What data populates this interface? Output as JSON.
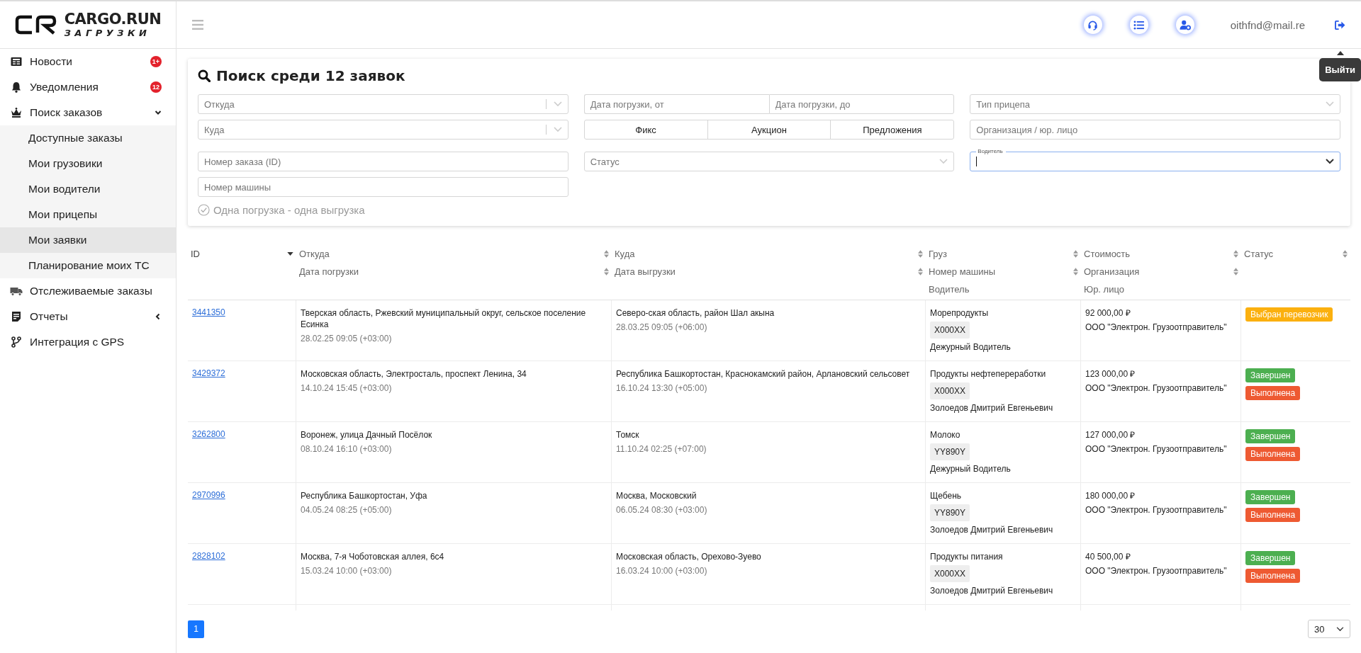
{
  "logo": {
    "name": "CARGO.RUN",
    "subtitle": "ЗАГРУЗКИ"
  },
  "sidebar": {
    "items": [
      {
        "label": "Новости",
        "badge": "1+",
        "selected": false
      },
      {
        "label": "Уведомления",
        "badge": "12",
        "selected": false
      },
      {
        "label": "Поиск заказов",
        "expanded": true,
        "selected": false,
        "children": [
          {
            "label": "Доступные заказы",
            "selected": false
          },
          {
            "label": "Мои грузовики",
            "selected": false
          },
          {
            "label": "Мои водители",
            "selected": false
          },
          {
            "label": "Мои прицепы",
            "selected": false
          },
          {
            "label": "Мои заявки",
            "selected": true
          },
          {
            "label": "Планирование моих ТС",
            "selected": false
          }
        ]
      },
      {
        "label": "Отслеживаемые заказы",
        "selected": false
      },
      {
        "label": "Отчеты",
        "expanded": false,
        "selected": false
      },
      {
        "label": "Интеграция с GPS",
        "selected": false
      }
    ]
  },
  "header": {
    "user": "oithfnd@mail.re",
    "tooltip": "Выйти"
  },
  "search": {
    "title": "Поиск среди 12 заявок",
    "columns": [
      [
        {
          "kind": "combo",
          "placeholder": "Откуда"
        },
        {
          "kind": "combo",
          "placeholder": "Куда"
        },
        {
          "kind": "input",
          "placeholder": "Номер заказа (ID)"
        },
        {
          "kind": "input",
          "placeholder": "Номер машины"
        },
        {
          "kind": "checkbox",
          "label": "Одна погрузка - одна выгрузка",
          "checked": false
        }
      ],
      [
        {
          "kind": "range",
          "placeholders": [
            "Дата погрузки, от",
            "Дата погрузки, до"
          ]
        },
        {
          "kind": "segmented",
          "options": [
            {
              "label": "Фикс",
              "selected": false
            },
            {
              "label": "Аукцион",
              "selected": false
            },
            {
              "label": "Предложения",
              "selected": false
            }
          ]
        },
        {
          "kind": "select",
          "placeholder": "Статус"
        }
      ],
      [
        {
          "kind": "select",
          "placeholder": "Тип прицепа"
        },
        {
          "kind": "input",
          "placeholder": "Организация / юр. лицо"
        },
        {
          "kind": "floating",
          "label": "Водитель",
          "focused": true
        }
      ]
    ]
  },
  "table": {
    "columns": [
      {
        "labels": [
          {
            "text": "ID",
            "sortable": true,
            "sorted": true
          }
        ]
      },
      {
        "labels": [
          {
            "text": "Откуда",
            "sortable": true,
            "sorted": false
          },
          {
            "text": "Дата погрузки",
            "sortable": true,
            "sorted": false
          }
        ]
      },
      {
        "labels": [
          {
            "text": "Куда",
            "sortable": true,
            "sorted": false
          },
          {
            "text": "Дата выгрузки",
            "sortable": true,
            "sorted": false
          }
        ]
      },
      {
        "labels": [
          {
            "text": "Груз",
            "sortable": true,
            "sorted": false
          },
          {
            "text": "Номер машины",
            "sortable": true,
            "sorted": false
          },
          {
            "text": "Водитель",
            "sortable": false,
            "sorted": false
          }
        ]
      },
      {
        "labels": [
          {
            "text": "Стоимость",
            "sortable": true,
            "sorted": false
          },
          {
            "text": "Организация",
            "sortable": true,
            "sorted": false
          },
          {
            "text": "Юр. лицо",
            "sortable": false,
            "sorted": false
          }
        ]
      },
      {
        "labels": [
          {
            "text": "Статус",
            "sortable": true,
            "sorted": false
          }
        ]
      }
    ],
    "rows": [
      {
        "id": "3441350",
        "from": "Тверская область, Ржевский муниципальный округ, сельское поселение Есинка",
        "load_date": "28.02.25 09:05 (+03:00)",
        "to": "Северо-ская область, район Шал акына",
        "unload_date": "28.03.25 09:05 (+06:00)",
        "cargo": "Морепродукты",
        "plate": "X000XX",
        "driver": "Дежурный Водитель",
        "price": "92 000,00 ₽",
        "org": "ООО \"Электрон. Грузоотправитель\"",
        "statuses": [
          {
            "text": "Выбран перевозчик",
            "color": "#fbb00f"
          }
        ]
      },
      {
        "id": "3429372",
        "from": "Московская область, Электросталь, проспект Ленина, 34",
        "load_date": "14.10.24 15:45 (+03:00)",
        "to": "Республика Башкортостан, Краснокамский район, Арлановский сельсовет",
        "unload_date": "16.10.24 13:30 (+05:00)",
        "cargo": "Продукты нефтепереработки",
        "plate": "X000XX",
        "driver": "Золоедов Дмитрий Евгеньевич",
        "price": "123 000,00 ₽",
        "org": "ООО \"Электрон. Грузоотправитель\"",
        "statuses": [
          {
            "text": "Завершен",
            "color": "#4caf50"
          },
          {
            "text": "Выполнена",
            "color": "#ee5a32"
          }
        ]
      },
      {
        "id": "3262800",
        "from": "Воронеж, улица Дачный Посёлок",
        "load_date": "08.10.24 16:10 (+03:00)",
        "to": "Томск",
        "unload_date": "11.10.24 02:25 (+07:00)",
        "cargo": "Молоко",
        "plate": "YY890Y",
        "driver": "Дежурный Водитель",
        "price": "127 000,00 ₽",
        "org": "ООО \"Электрон. Грузоотправитель\"",
        "statuses": [
          {
            "text": "Завершен",
            "color": "#4caf50"
          },
          {
            "text": "Выполнена",
            "color": "#ee5a32"
          }
        ]
      },
      {
        "id": "2970996",
        "from": "Республика Башкортостан, Уфа",
        "load_date": "04.05.24 08:25 (+05:00)",
        "to": "Москва, Московский",
        "unload_date": "06.05.24 08:30 (+03:00)",
        "cargo": "Щебень",
        "plate": "YY890Y",
        "driver": "Золоедов Дмитрий Евгеньевич",
        "price": "180 000,00 ₽",
        "org": "ООО \"Электрон. Грузоотправитель\"",
        "statuses": [
          {
            "text": "Завершен",
            "color": "#4caf50"
          },
          {
            "text": "Выполнена",
            "color": "#ee5a32"
          }
        ]
      },
      {
        "id": "2828102",
        "from": "Москва, 7-я Чоботовская аллея, 6с4",
        "load_date": "15.03.24 10:00 (+03:00)",
        "to": "Московская область, Орехово-Зуево",
        "unload_date": "16.03.24 10:00 (+03:00)",
        "cargo": "Продукты питания",
        "plate": "X000XX",
        "driver": "Золоедов Дмитрий Евгеньевич",
        "price": "40 500,00 ₽",
        "org": "ООО \"Электрон. Грузоотправитель\"",
        "statuses": [
          {
            "text": "Завершен",
            "color": "#4caf50"
          },
          {
            "text": "Выполнена",
            "color": "#ee5a32"
          }
        ]
      }
    ]
  },
  "pagination": {
    "pages": [
      {
        "label": "1",
        "selected": true
      }
    ],
    "page_size": "30"
  }
}
